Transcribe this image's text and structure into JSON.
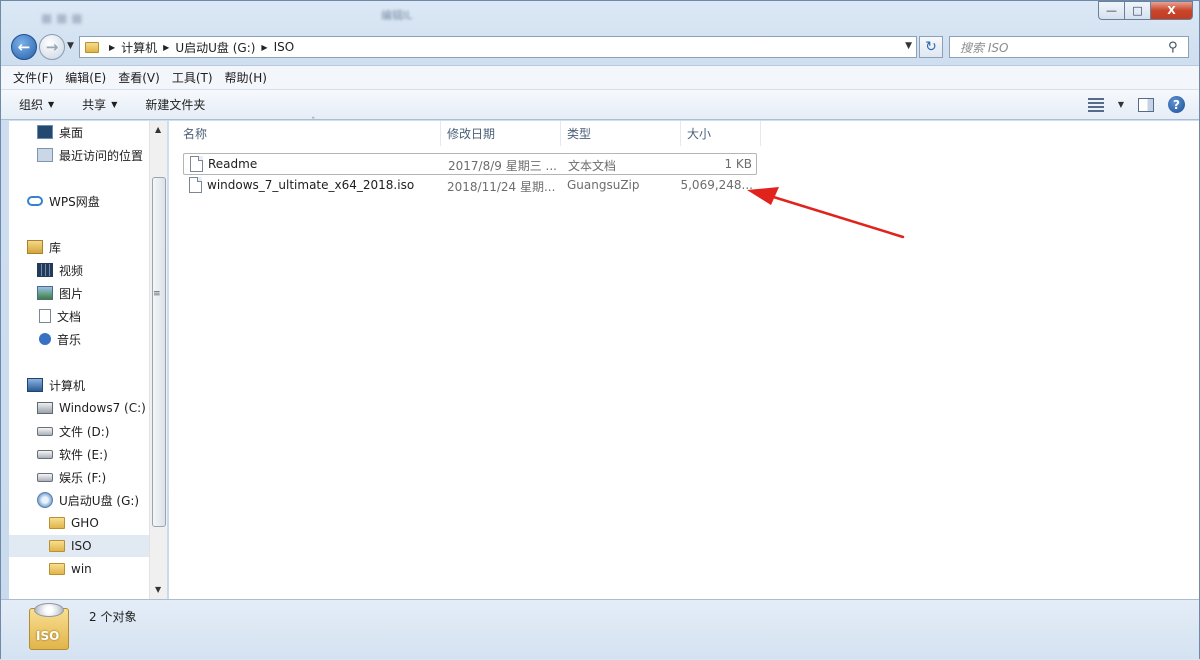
{
  "title": {
    "blur_text": "编辑IL"
  },
  "window_controls": {
    "minimize": "—",
    "maximize": "□",
    "close": "X"
  },
  "address": {
    "segments": [
      "计算机",
      "U启动U盘 (G:)",
      "ISO"
    ],
    "search_placeholder": "搜索 ISO"
  },
  "menu": [
    "文件(F)",
    "编辑(E)",
    "查看(V)",
    "工具(T)",
    "帮助(H)"
  ],
  "commands": {
    "organize": "组织",
    "share": "共享",
    "new_folder": "新建文件夹"
  },
  "nav": {
    "desktop": "桌面",
    "recent": "最近访问的位置",
    "wps": "WPS网盘",
    "library": "库",
    "video": "视频",
    "pictures": "图片",
    "documents": "文档",
    "music": "音乐",
    "computer": "计算机",
    "drive_c": "Windows7 (C:)",
    "drive_d": "文件 (D:)",
    "drive_e": "软件 (E:)",
    "drive_f": "娱乐 (F:)",
    "drive_g": "U启动U盘 (G:)",
    "folder_gho": "GHO",
    "folder_iso": "ISO",
    "folder_win": "win"
  },
  "columns": {
    "name": "名称",
    "date": "修改日期",
    "type": "类型",
    "size": "大小"
  },
  "files": [
    {
      "name": "Readme",
      "date": "2017/8/9 星期三 ...",
      "type": "文本文档",
      "size": "1 KB"
    },
    {
      "name": "windows_7_ultimate_x64_2018.iso",
      "date": "2018/11/24 星期...",
      "type": "GuangsuZip",
      "size": "5,069,248..."
    }
  ],
  "status": {
    "count": "2 个对象",
    "icon_label": "ISO"
  },
  "colors": {
    "accent": "#2960a8",
    "annotation_arrow": "#e0231c"
  }
}
